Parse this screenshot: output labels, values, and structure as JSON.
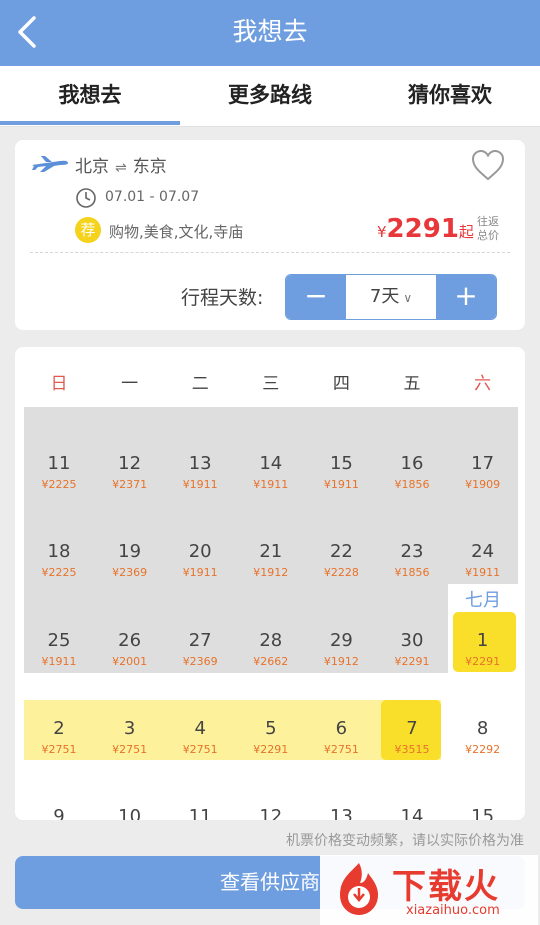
{
  "header": {
    "title": "我想去"
  },
  "tabs": [
    {
      "label": "我想去",
      "active": true
    },
    {
      "label": "更多路线",
      "active": false
    },
    {
      "label": "猜你喜欢",
      "active": false
    }
  ],
  "trip": {
    "from": "北京",
    "to": "东京",
    "route_arrow": "⇌",
    "dates": "07.01 - 07.07",
    "tag_badge": "荐",
    "tags": "购物,美食,文化,寺庙",
    "price": {
      "currency": "¥",
      "amount": "2291",
      "suffix": "起",
      "note_line1": "往返",
      "note_line2": "总价"
    },
    "days_label": "行程天数:",
    "days_value": "7天",
    "minus_label": "−",
    "plus_label": "+"
  },
  "calendar": {
    "weekdays": [
      "日",
      "一",
      "二",
      "三",
      "四",
      "五",
      "六"
    ],
    "month_label": "七月",
    "rows": [
      [
        {
          "day": "11",
          "price": "¥2225"
        },
        {
          "day": "12",
          "price": "¥2371"
        },
        {
          "day": "13",
          "price": "¥1911"
        },
        {
          "day": "14",
          "price": "¥1911"
        },
        {
          "day": "15",
          "price": "¥1911"
        },
        {
          "day": "16",
          "price": "¥1856"
        },
        {
          "day": "17",
          "price": "¥1909"
        }
      ],
      [
        {
          "day": "18",
          "price": "¥2225"
        },
        {
          "day": "19",
          "price": "¥2369"
        },
        {
          "day": "20",
          "price": "¥1911"
        },
        {
          "day": "21",
          "price": "¥1912"
        },
        {
          "day": "22",
          "price": "¥2228"
        },
        {
          "day": "23",
          "price": "¥1856"
        },
        {
          "day": "24",
          "price": "¥1911"
        }
      ],
      [
        {
          "day": "25",
          "price": "¥1911"
        },
        {
          "day": "26",
          "price": "¥2001"
        },
        {
          "day": "27",
          "price": "¥2369"
        },
        {
          "day": "28",
          "price": "¥2662"
        },
        {
          "day": "29",
          "price": "¥1912"
        },
        {
          "day": "30",
          "price": "¥2291"
        },
        {
          "day": "1",
          "price": "¥2291"
        }
      ],
      [
        {
          "day": "2",
          "price": "¥2751"
        },
        {
          "day": "3",
          "price": "¥2751"
        },
        {
          "day": "4",
          "price": "¥2751"
        },
        {
          "day": "5",
          "price": "¥2291"
        },
        {
          "day": "6",
          "price": "¥2751"
        },
        {
          "day": "7",
          "price": "¥3515"
        },
        {
          "day": "8",
          "price": "¥2292"
        }
      ],
      [
        {
          "day": "9",
          "price": ""
        },
        {
          "day": "10",
          "price": ""
        },
        {
          "day": "11",
          "price": ""
        },
        {
          "day": "12",
          "price": ""
        },
        {
          "day": "13",
          "price": ""
        },
        {
          "day": "14",
          "price": ""
        },
        {
          "day": "15",
          "price": ""
        }
      ]
    ]
  },
  "footnote": "机票价格变动频繁，请以实际价格为准",
  "bottom_button": "查看供应商",
  "watermark": {
    "text": "下载火",
    "url": "xiazaihuo.com"
  },
  "colors": {
    "accent": "#6f9ee0",
    "price_red": "#e8373a",
    "highlight": "#f9df2a",
    "band": "#fdf29b"
  }
}
